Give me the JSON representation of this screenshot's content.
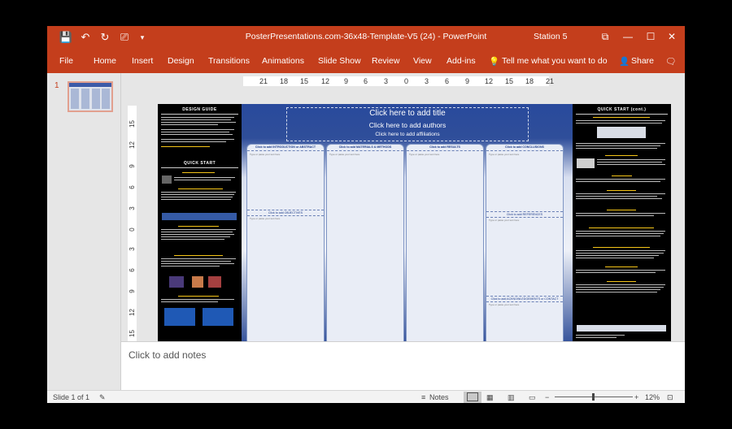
{
  "window": {
    "title": "PosterPresentations.com-36x48-Template-V5 (24)  -  PowerPoint",
    "station": "Station 5",
    "quick_access": {
      "save": "💾",
      "undo": "↶",
      "redo": "↻",
      "start": "⎚",
      "more": "▾"
    },
    "controls": {
      "ribbon_display": "⧉",
      "minimize": "—",
      "maximize": "☐",
      "close": "✕"
    }
  },
  "ribbon": {
    "tabs": [
      "File",
      "Home",
      "Insert",
      "Design",
      "Transitions",
      "Animations",
      "Slide Show",
      "Review",
      "View",
      "Add-ins"
    ],
    "tell_me": "Tell me what you want to do",
    "share": "Share"
  },
  "thumbnails": {
    "slide_number": "1"
  },
  "rulers": {
    "horizontal": [
      "21",
      "18",
      "15",
      "12",
      "9",
      "6",
      "3",
      "0",
      "3",
      "6",
      "9",
      "12",
      "15",
      "18",
      "21"
    ],
    "vertical": [
      "15",
      "12",
      "9",
      "6",
      "3",
      "0",
      "3",
      "6",
      "9",
      "12",
      "15"
    ]
  },
  "slide": {
    "title_placeholder": "Click here to add title",
    "authors_placeholder": "Click here to add authors",
    "affiliations_placeholder": "Click here to add affiliations",
    "left_panel": {
      "design_guide_title": "DESIGN GUIDE",
      "quick_start_title": "QUICK START"
    },
    "right_panel": {
      "quick_start_cont_title": "QUICK START (cont.)"
    },
    "columns": [
      {
        "head": "Click to add INTRODUCTION or ABSTRACT",
        "type_text": "Type or paste your text here",
        "sub_head": "Click to add OBJECTIVES"
      },
      {
        "head": "Click to add MATERIALS & METHODS",
        "type_text": "Type or paste your text here"
      },
      {
        "head": "Click to add RESULTS",
        "type_text": "Type or paste your text here"
      },
      {
        "head": "Click to add CONCLUSIONS",
        "type_text": "Type or paste your text here",
        "sub_head": "Click to add REFERENCES",
        "sub_head2": "Click to add ACKNOWLEDGEMENTS or CONTACT"
      }
    ]
  },
  "notes": {
    "placeholder": "Click to add notes"
  },
  "status": {
    "slide_info": "Slide 1 of 1",
    "notes_button": "Notes",
    "zoom_minus": "−",
    "zoom_plus": "+",
    "zoom_level": "12%"
  },
  "colors": {
    "accent": "#c43e1c",
    "poster_blue": "#294a9c"
  }
}
